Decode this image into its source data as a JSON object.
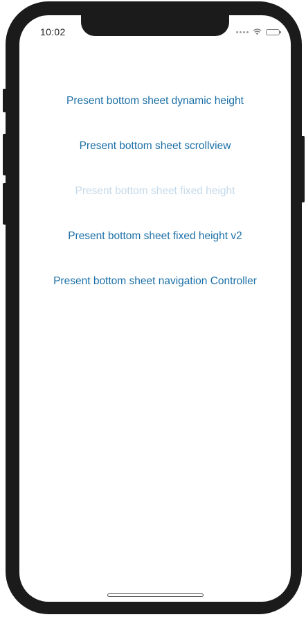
{
  "status_bar": {
    "time": "10:02",
    "signal_icon": "cellular-signal-icon",
    "wifi_icon": "wifi-icon",
    "battery_icon": "battery-icon"
  },
  "menu": {
    "items": [
      {
        "label": "Present bottom sheet dynamic height",
        "enabled": true
      },
      {
        "label": "Present bottom sheet scrollview",
        "enabled": true
      },
      {
        "label": "Present bottom sheet fixed height",
        "enabled": false
      },
      {
        "label": "Present bottom sheet fixed height v2",
        "enabled": true
      },
      {
        "label": "Present bottom sheet navigation Controller",
        "enabled": true
      }
    ]
  },
  "colors": {
    "link": "#1b6fa6",
    "disabled_link": "#c5d9ea",
    "device_frame": "#1b1b1b",
    "screen": "#ffffff"
  }
}
